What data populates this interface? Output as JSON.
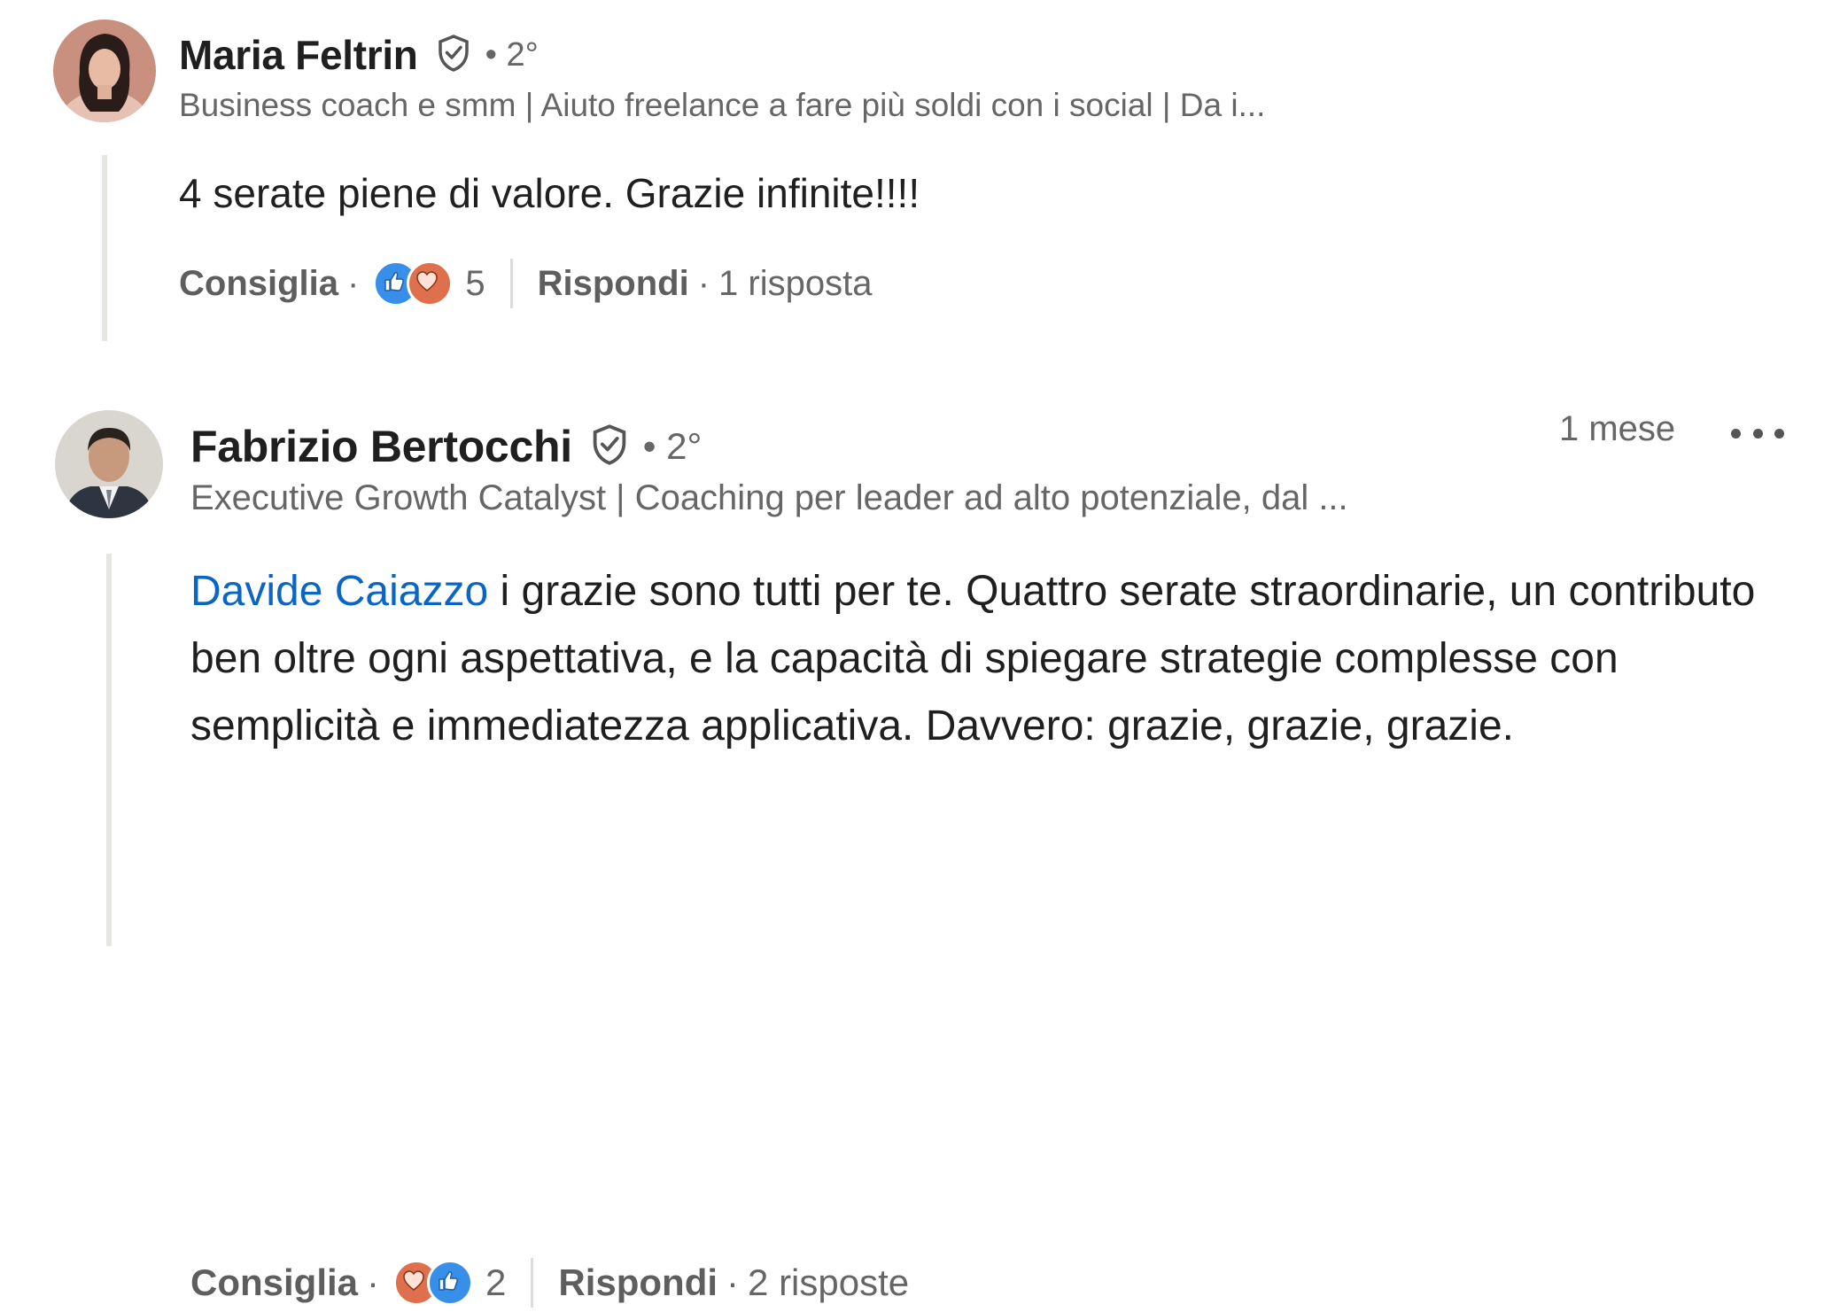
{
  "comments": [
    {
      "author": "Maria Feltrin",
      "degree": "• 2°",
      "headline": "Business coach e smm | Aiuto freelance a fare più soldi con i social | Da i...",
      "text": "4 serate piene di valore. Grazie infinite!!!!",
      "like_label": "Consiglia",
      "reactions": [
        "like-icon",
        "love-icon"
      ],
      "reaction_count": "5",
      "reply_label": "Rispondi",
      "replies": "1 risposta"
    },
    {
      "author": "Fabrizio Bertocchi",
      "degree": "• 2°",
      "headline": "Executive Growth Catalyst | Coaching per leader ad alto potenziale, dal ...",
      "timestamp": "1 mese",
      "mention": "Davide Caiazzo",
      "text": " i grazie sono tutti per te. Quattro serate straordinarie, un contributo ben oltre ogni aspettativa, e la capacità di spiegare strategie complesse con semplicità e immediatezza applicativa. Davvero: grazie, grazie, grazie.",
      "like_label": "Consiglia",
      "reactions": [
        "love-icon",
        "like-icon"
      ],
      "reaction_count": "2",
      "reply_label": "Rispondi",
      "replies": "2 risposte"
    }
  ],
  "colors": {
    "link": "#0a66c2",
    "like": "#378fe9",
    "love": "#df704d",
    "verified": "#555555",
    "muted_text": "#666666"
  }
}
